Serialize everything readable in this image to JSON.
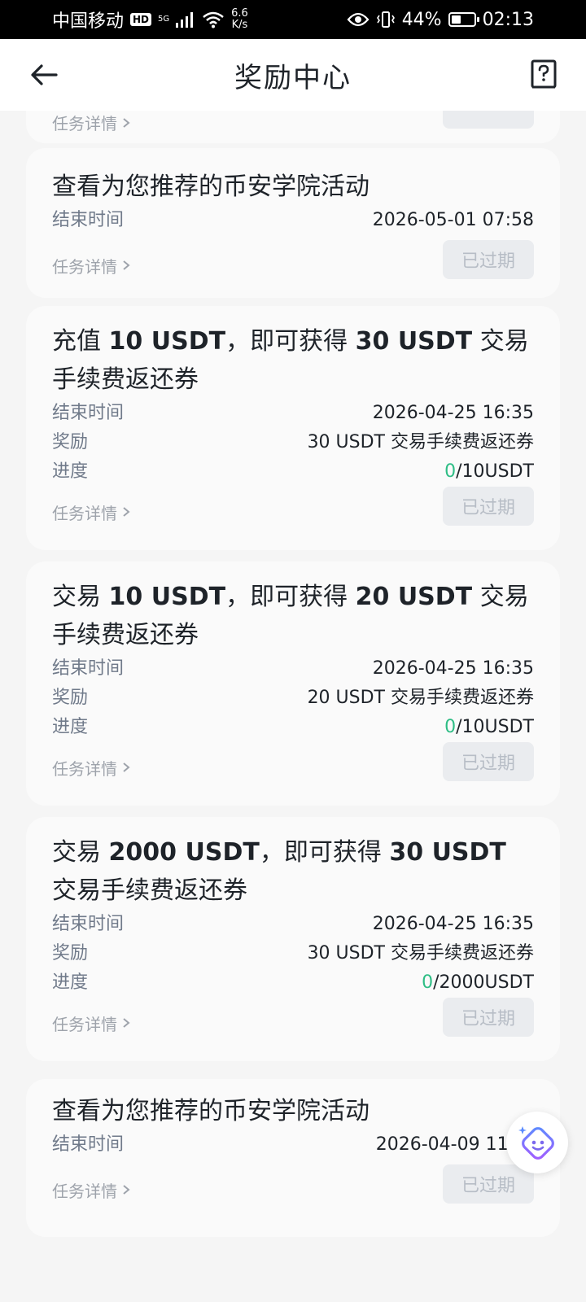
{
  "status_bar": {
    "carrier": "中国移动",
    "hd": "HD",
    "signal_label": "5G",
    "net_speed_value": "6.6",
    "net_speed_unit": "K/s",
    "battery_percent": "44%",
    "battery_level": 0.44,
    "time": "02:13"
  },
  "header": {
    "title": "奖励中心"
  },
  "cards": [
    {
      "title_html": "查看为您推荐的币安学院活动",
      "end_label": "结束时间",
      "end_value": "2026-05-01 07:58",
      "detail_label": "任务详情",
      "button_label": "已过期"
    },
    {
      "title_parts": [
        "充值 ",
        "10 USDT",
        "，即可获得 ",
        "30 USDT",
        " 交易手续费返还券"
      ],
      "end_label": "结束时间",
      "end_value": "2026-04-25 16:35",
      "reward_label": "奖励",
      "reward_value": "30 USDT 交易手续费返还券",
      "progress_label": "进度",
      "progress_current": "0",
      "progress_total": "/10USDT",
      "detail_label": "任务详情",
      "button_label": "已过期"
    },
    {
      "title_parts": [
        "交易 ",
        "10 USDT",
        "，即可获得 ",
        "20 USDT",
        " 交易手续费返还券"
      ],
      "end_label": "结束时间",
      "end_value": "2026-04-25 16:35",
      "reward_label": "奖励",
      "reward_value": "20 USDT 交易手续费返还券",
      "progress_label": "进度",
      "progress_current": "0",
      "progress_total": "/10USDT",
      "detail_label": "任务详情",
      "button_label": "已过期"
    },
    {
      "title_parts": [
        "交易 ",
        "2000 USDT",
        "，即可获得 ",
        "30 USDT",
        " 交易手续费返还券"
      ],
      "end_label": "结束时间",
      "end_value": "2026-04-25 16:35",
      "reward_label": "奖励",
      "reward_value": "30 USDT 交易手续费返还券",
      "progress_label": "进度",
      "progress_current": "0",
      "progress_total": "/2000USDT",
      "detail_label": "任务详情",
      "button_label": "已过期"
    },
    {
      "title_html": "查看为您推荐的币安学院活动",
      "end_label": "结束时间",
      "end_value": "2026-04-09 11:",
      "detail_label": "任务详情",
      "button_label": "已过期"
    }
  ],
  "partial_top": {
    "detail_label": "任务详情"
  },
  "icons": {
    "back": "arrow-left-icon",
    "help": "question-book-icon",
    "chevron": "chevron-right-icon",
    "float": "ai-assistant-icon"
  },
  "colors": {
    "accent_green": "#2ebd85",
    "card_bg": "#fafafa",
    "page_bg": "#f5f5f5",
    "float_icon": "#7b68ee"
  }
}
